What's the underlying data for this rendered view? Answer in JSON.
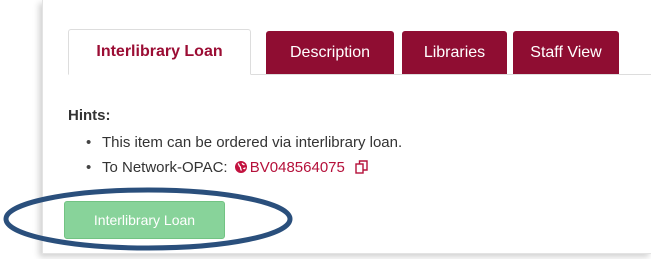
{
  "tabs": [
    {
      "label": "Interlibrary Loan",
      "active": true
    },
    {
      "label": "Description",
      "active": false
    },
    {
      "label": "Libraries",
      "active": false
    },
    {
      "label": "Staff View",
      "active": false
    }
  ],
  "hints": {
    "label": "Hints:",
    "item_1": "This item can be ordered via interlibrary loan.",
    "item_2_prefix": "To Network-OPAC:",
    "item_2_link": "BV048564075",
    "bullet": "•"
  },
  "action_button": {
    "label": "Interlibrary Loan"
  },
  "icons": {
    "link": "globe-icon",
    "copy": "copy-icon"
  },
  "colors": {
    "tab_inactive_bg": "#8f0d32",
    "tab_active_text": "#9b0d34",
    "link": "#b5103a",
    "button_bg": "#88d39a",
    "highlight_ellipse": "#2a4f7c"
  }
}
